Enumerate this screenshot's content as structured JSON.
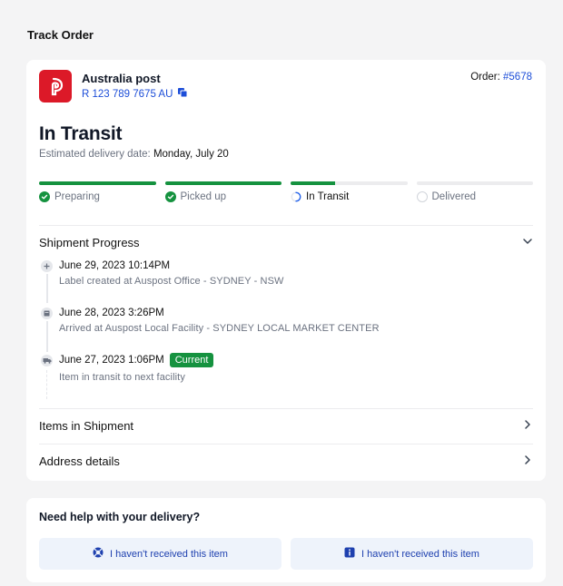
{
  "page": {
    "title": "Track Order"
  },
  "carrier": {
    "name": "Australia post",
    "tracking_number": "R 123 789 7675 AU",
    "logo_color": "#dc1928",
    "copy_icon": "copy-icon"
  },
  "order": {
    "label": "Order:",
    "number": "#5678"
  },
  "status": {
    "title": "In Transit",
    "estimated_label": "Estimated delivery date:",
    "estimated_date": "Monday, July 20"
  },
  "steps": [
    {
      "label": "Preparing",
      "state": "done",
      "progress": 1.0
    },
    {
      "label": "Picked up",
      "state": "done",
      "progress": 1.0
    },
    {
      "label": "In Transit",
      "state": "current",
      "progress": 0.38
    },
    {
      "label": "Delivered",
      "state": "pending",
      "progress": 0.0
    }
  ],
  "shipment_progress": {
    "title": "Shipment Progress",
    "events": [
      {
        "date": "June 29, 2023 10:14PM",
        "description": "Label created at Auspost Office - SYDNEY - NSW",
        "icon": "plus-icon",
        "current": false
      },
      {
        "date": "June 28, 2023 3:26PM",
        "description": "Arrived at Auspost Local Facility - SYDNEY LOCAL MARKET CENTER",
        "icon": "building-icon",
        "current": false
      },
      {
        "date": "June 27, 2023 1:06PM",
        "description": "Item in transit to next facility",
        "icon": "truck-icon",
        "current": true,
        "badge": "Current"
      }
    ]
  },
  "sections": {
    "items": "Items in Shipment",
    "address": "Address details"
  },
  "help": {
    "title": "Need help with your delivery?",
    "buttons": [
      {
        "label": "I haven't received this item",
        "icon": "lifebuoy-icon"
      },
      {
        "label": "I haven't received this item",
        "icon": "info-icon"
      }
    ]
  },
  "colors": {
    "accent": "#1d4ed8",
    "success": "#15923f",
    "brand": "#dc1928"
  }
}
